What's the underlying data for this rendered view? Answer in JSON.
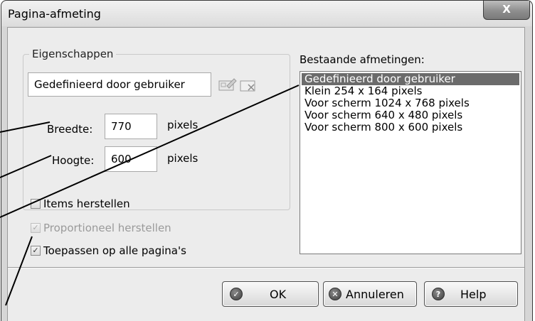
{
  "window": {
    "title": "Pagina-afmeting",
    "close_label": "X"
  },
  "properties": {
    "group_label": "Eigenschappen",
    "name_value": "Gedefinieerd door gebruiker",
    "width_label": "Breedte:",
    "width_value": "770",
    "width_unit": "pixels",
    "height_label": "Hoogte:",
    "height_value": "600",
    "height_unit": "pixels"
  },
  "existing_sizes": {
    "label": "Bestaande afmetingen:",
    "items": [
      {
        "label": "Gedefinieerd door gebruiker",
        "selected": true
      },
      {
        "label": "Klein 254 x 164 pixels",
        "selected": false
      },
      {
        "label": "Voor scherm 1024 x 768 pixels",
        "selected": false
      },
      {
        "label": "Voor scherm 640 x 480 pixels",
        "selected": false
      },
      {
        "label": "Voor scherm 800 x 600 pixels",
        "selected": false
      }
    ]
  },
  "options": [
    {
      "label": "Items herstellen",
      "checked": false,
      "disabled": false
    },
    {
      "label": "Proportioneel herstellen",
      "checked": true,
      "disabled": true
    },
    {
      "label": "Toepassen op alle pagina's",
      "checked": true,
      "disabled": false
    }
  ],
  "buttons": {
    "ok": "OK",
    "cancel": "Annuleren",
    "help": "Help"
  },
  "icons": {
    "save_size": "save-size-icon",
    "delete_size": "delete-size-icon",
    "ok": "checkmark-icon",
    "cancel": "cancel-icon",
    "help": "question-icon"
  },
  "colors": {
    "selection": "#6b6b6b",
    "dialog_bg": "#ececec"
  }
}
